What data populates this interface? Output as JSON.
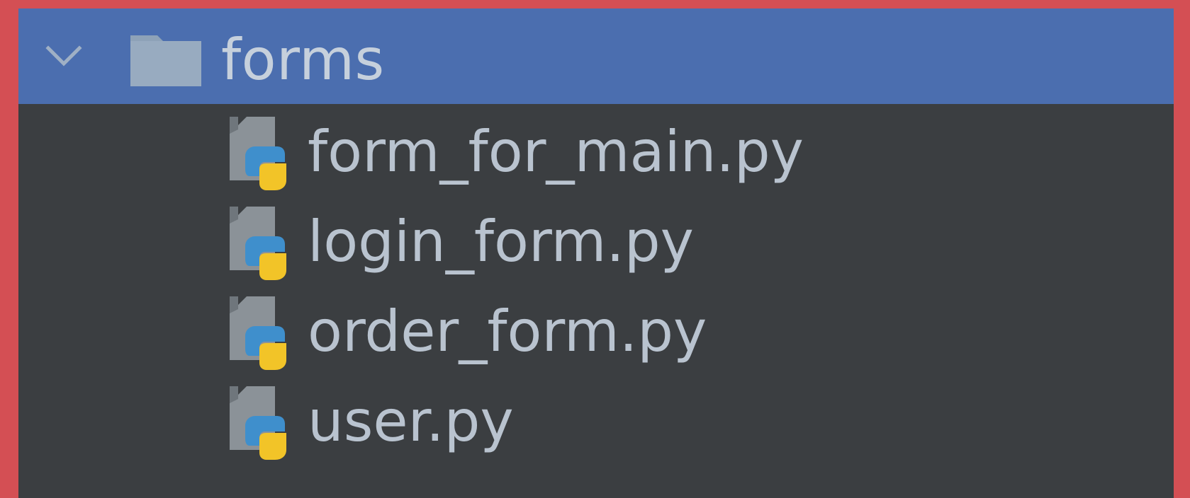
{
  "project_tree": {
    "folder": {
      "name": "forms",
      "expanded": true,
      "icon": "folder-icon",
      "expand_icon": "chevron-down-icon"
    },
    "files": [
      {
        "name": "form_for_main.py",
        "icon": "python-file-icon"
      },
      {
        "name": "login_form.py",
        "icon": "python-file-icon"
      },
      {
        "name": "order_form.py",
        "icon": "python-file-icon"
      },
      {
        "name": "user.py",
        "icon": "python-file-icon"
      }
    ]
  },
  "colors": {
    "frame_border": "#d44f54",
    "panel_background": "#3b3e41",
    "selected_row": "#4b6eaf",
    "text": "#b9c3cf",
    "python_blue": "#3f8fcc",
    "python_yellow": "#f2c428"
  }
}
